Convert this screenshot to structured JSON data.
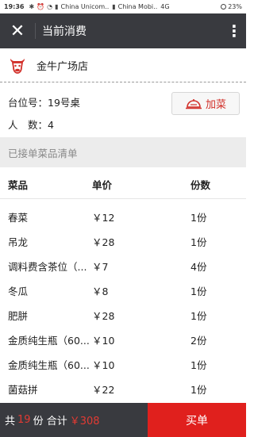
{
  "statusbar": {
    "time": "19:36",
    "carrier1": "China Unicom..",
    "carrier2": "China Mobi..",
    "network": "4G",
    "battery": "23%"
  },
  "header": {
    "title": "当前消费"
  },
  "store": {
    "name": "金牛广场店"
  },
  "order_info": {
    "table_label": "台位号：19号桌",
    "people_label": "人　数：4",
    "add_button": "加菜"
  },
  "section": {
    "title": "已接单菜品清单"
  },
  "table": {
    "headers": {
      "name": "菜品",
      "price": "单价",
      "qty": "份数"
    },
    "rows": [
      {
        "name": "春菜",
        "price": "￥12",
        "qty": "1份"
      },
      {
        "name": "吊龙",
        "price": "￥28",
        "qty": "1份"
      },
      {
        "name": "调料费含茶位（...",
        "price": "￥7",
        "qty": "4份"
      },
      {
        "name": "冬瓜",
        "price": "￥8",
        "qty": "1份"
      },
      {
        "name": "肥胼",
        "price": "￥28",
        "qty": "1份"
      },
      {
        "name": "金质纯生瓶（60...",
        "price": "￥10",
        "qty": "2份"
      },
      {
        "name": "金质纯生瓶（60...",
        "price": "￥10",
        "qty": "1份"
      },
      {
        "name": "菌菇拼",
        "price": "￥22",
        "qty": "1份"
      },
      {
        "name": "",
        "price": "",
        "qty": ""
      }
    ]
  },
  "footer": {
    "total_prefix": "共",
    "total_count": "19",
    "total_mid": "份 合计",
    "total_amount": "￥308",
    "buy_button": "买单"
  },
  "colors": {
    "topbar": "#393a3f",
    "accent_red": "#e0201d",
    "section_bg": "#ececec"
  }
}
